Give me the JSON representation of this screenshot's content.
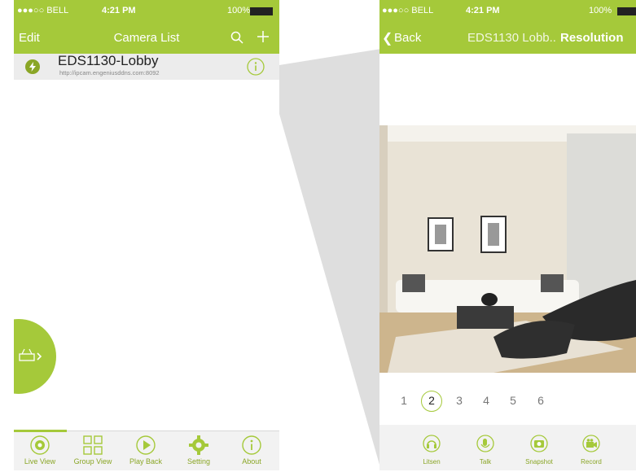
{
  "colors": {
    "accent": "#a5c93a",
    "accent_dark": "#8aa626"
  },
  "left_screen": {
    "status": {
      "carrier": "●●●○○ BELL",
      "time": "4:21 PM",
      "battery": "100%"
    },
    "nav": {
      "edit": "Edit",
      "title": "Camera List"
    },
    "camera": {
      "name": "EDS1130-Lobby",
      "url": "http://ipcam.engeniusddns.com:8092"
    },
    "tabs": [
      {
        "label": "Live View",
        "icon": "eye-icon"
      },
      {
        "label": "Group View",
        "icon": "grid-icon"
      },
      {
        "label": "Play Back",
        "icon": "play-icon"
      },
      {
        "label": "Setting",
        "icon": "gear-icon"
      },
      {
        "label": "About",
        "icon": "info-icon"
      }
    ]
  },
  "right_screen": {
    "status": {
      "carrier": "●●●○○ BELL",
      "time": "4:21 PM",
      "battery": "100%"
    },
    "nav": {
      "back": "Back",
      "title": "EDS1130 Lobb..",
      "resolution": "Resolution"
    },
    "pages": [
      "1",
      "2",
      "3",
      "4",
      "5",
      "6"
    ],
    "selected_page": "2",
    "controls": [
      {
        "label": "Litsen",
        "icon": "headphones-icon"
      },
      {
        "label": "Talk",
        "icon": "microphone-icon"
      },
      {
        "label": "Snapshot",
        "icon": "camera-icon"
      },
      {
        "label": "Record",
        "icon": "video-camera-icon"
      }
    ]
  }
}
